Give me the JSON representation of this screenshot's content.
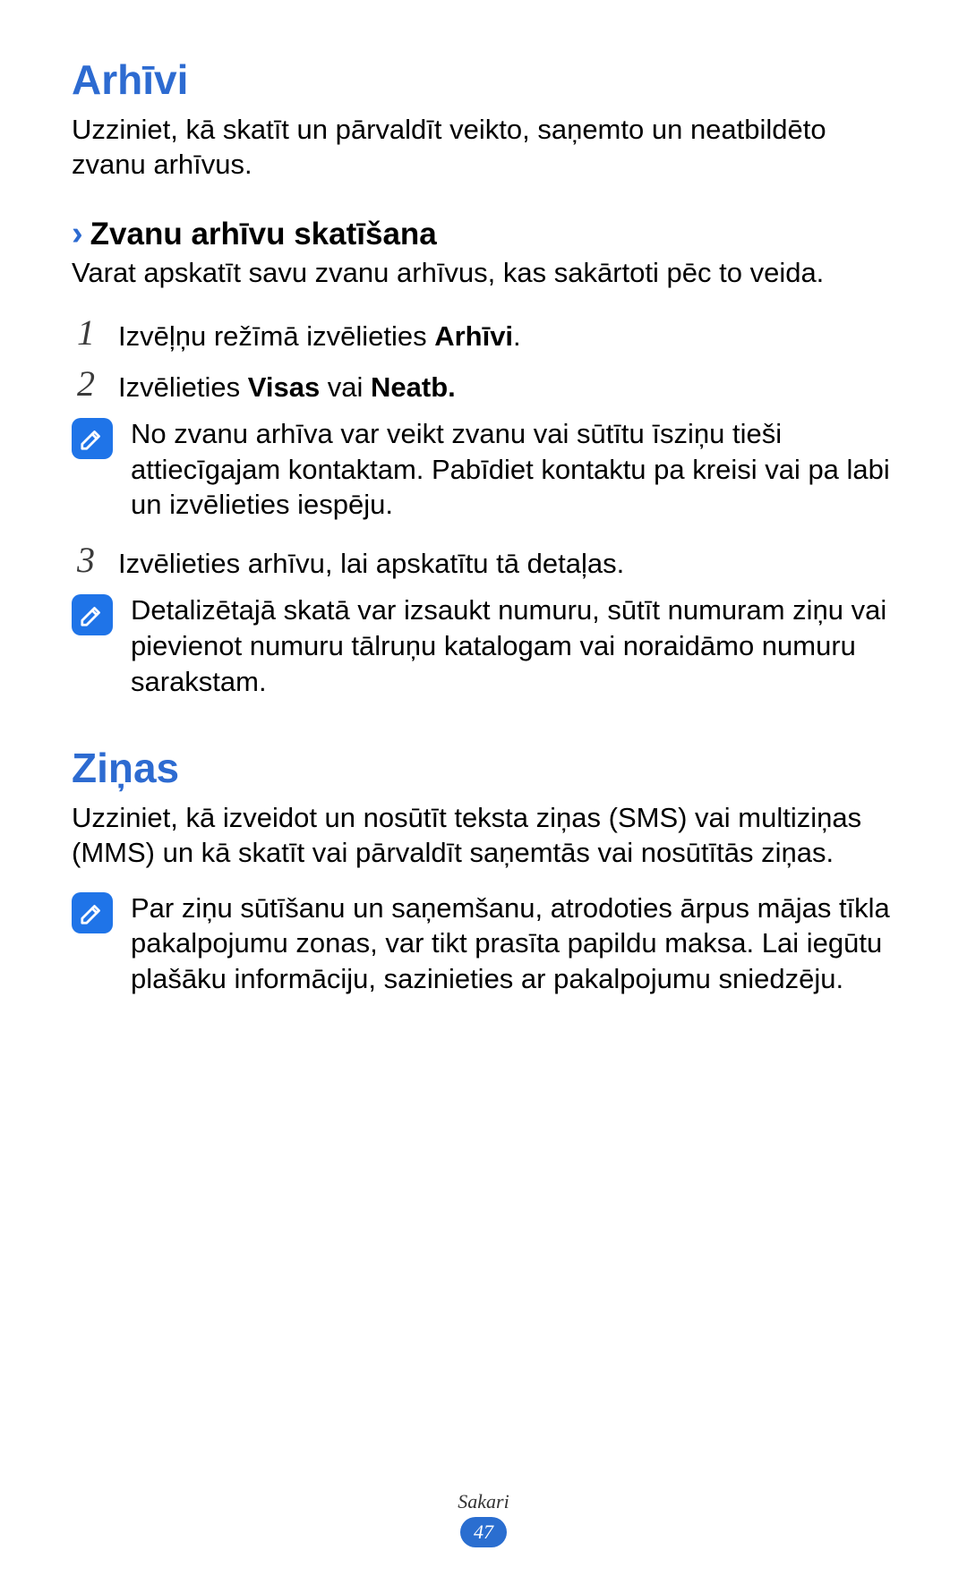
{
  "section1": {
    "title": "Arhīvi",
    "intro": "Uzziniet, kā skatīt un pārvaldīt veikto, saņemto un neatbildēto zvanu arhīvus.",
    "sub_chevron": "›",
    "sub_title": "Zvanu arhīvu skatīšana",
    "sub_intro": "Varat apskatīt savu zvanu arhīvus, kas sakārtoti pēc to veida.",
    "steps": {
      "n1": "1",
      "s1a": "Izvēļņu režīmā izvēlieties ",
      "s1b": "Arhīvi",
      "s1c": ".",
      "n2": "2",
      "s2a": "Izvēlieties ",
      "s2b": "Visas",
      "s2c": " vai ",
      "s2d": "Neatb.",
      "note1": "No zvanu arhīva var veikt zvanu vai sūtītu īsziņu tieši attiecīgajam kontaktam. Pabīdiet kontaktu pa kreisi vai pa labi un izvēlieties iespēju.",
      "n3": "3",
      "s3": "Izvēlieties arhīvu, lai apskatītu tā detaļas.",
      "note2": "Detalizētajā skatā var izsaukt numuru, sūtīt numuram ziņu vai pievienot numuru tālruņu katalogam vai noraidāmo numuru sarakstam."
    }
  },
  "section2": {
    "title": "Ziņas",
    "intro": "Uzziniet, kā izveidot un nosūtīt teksta ziņas (SMS) vai multiziņas (MMS) un kā skatīt vai pārvaldīt saņemtās vai nosūtītās ziņas.",
    "note": "Par ziņu sūtīšanu un saņemšanu, atrodoties ārpus mājas tīkla pakalpojumu zonas, var tikt prasīta papildu maksa. Lai iegūtu plašāku informāciju, sazinieties ar pakalpojumu sniedzēju."
  },
  "footer": {
    "category": "Sakari",
    "page": "47"
  }
}
